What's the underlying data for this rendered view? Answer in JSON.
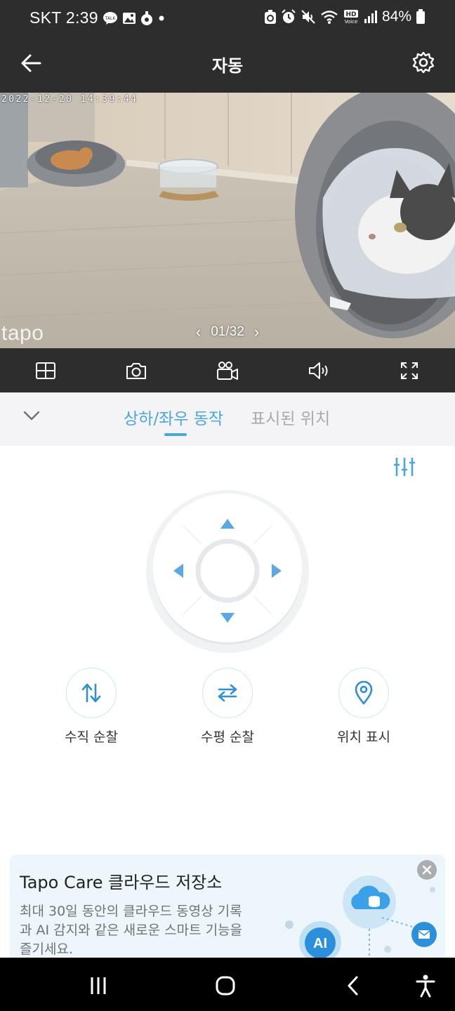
{
  "status_bar": {
    "carrier_time": "SKT 2:39",
    "battery": "84%",
    "left_icons": [
      "talk-icon",
      "gallery-icon",
      "recorder-icon",
      "dot-icon"
    ],
    "right_icons": [
      "sync-icon",
      "alarm-icon",
      "mute-icon",
      "wifi-icon",
      "hd-voice-icon",
      "signal-icon",
      "battery-icon"
    ]
  },
  "header": {
    "title": "자동",
    "back_icon": "back-arrow-icon",
    "settings_icon": "gear-icon"
  },
  "camera": {
    "timestamp": "2022-12-20 14:39:44",
    "watermark": "tapo",
    "pager": "01/32"
  },
  "toolbar": {
    "items": [
      "multi-view-icon",
      "camera-icon",
      "video-record-icon",
      "speaker-icon",
      "fullscreen-icon"
    ]
  },
  "tabs": {
    "items": [
      {
        "label": "상하/좌우 동작",
        "active": true
      },
      {
        "label": "표시된 위치",
        "active": false
      }
    ]
  },
  "control": {
    "actions": [
      {
        "label": "수직 순찰",
        "icon": "vertical-patrol-icon"
      },
      {
        "label": "수평 순찰",
        "icon": "horizontal-patrol-icon"
      },
      {
        "label": "위치 표시",
        "icon": "location-pin-icon"
      }
    ]
  },
  "promo": {
    "title": "Tapo Care 클라우드 저장소",
    "body": "최대 30일 동안의 클라우드 동영상 기록과 AI 감지와 같은 새로운 스마트 기능을 즐기세요.",
    "ai_badge": "AI"
  },
  "colors": {
    "accent": "#4aa7de",
    "dark_bar": "#2d2d2d",
    "promo_bg": "#edf6fb"
  }
}
